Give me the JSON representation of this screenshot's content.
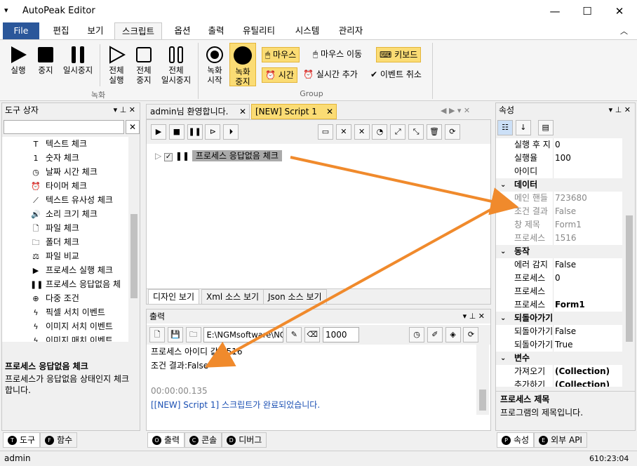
{
  "app": {
    "title": "AutoPeak Editor",
    "menu_glyph": "▾",
    "min": "—",
    "max": "☐",
    "close": "✕",
    "collapse": "︿"
  },
  "menu_tabs": [
    "File",
    "편집",
    "보기",
    "스크립트",
    "옵션",
    "출력",
    "유틸리티",
    "시스템",
    "관리자"
  ],
  "ribbon": {
    "run": "실행",
    "stop": "중지",
    "pause": "일시중지",
    "run_all_1": "전체",
    "run_all_2": "실행",
    "stop_all_1": "전체",
    "stop_all_2": "중지",
    "pause_all_1": "전체",
    "pause_all_2": "일시중지",
    "rec_start_1": "녹화",
    "rec_start_2": "시작",
    "rec_stop_1": "녹화",
    "rec_stop_2": "중지",
    "mouse": "마우스",
    "mouse_move": "마우스 이동",
    "keyboard": "키보드",
    "time": "시간",
    "realtime_add": "실시간 추가",
    "event_cancel": "이벤트 취소",
    "group_record": "녹화",
    "group_group": "Group"
  },
  "toolbox": {
    "title": "도구 상자",
    "search_value": "",
    "items": [
      "텍스트 체크",
      "숫자 체크",
      "날짜 시간 체크",
      "타이머 체크",
      "텍스트 유사성 체크",
      "소리 크기 체크",
      "파일 체크",
      "폴더 체크",
      "파일 비교",
      "프로세스 실행 체크",
      "프로세스 응답없음 체",
      "다중 조건",
      "픽셀 서치 이벤트",
      "이미지 서치 이벤트",
      "이미지 매치 이벤트"
    ],
    "item_icons": [
      "T",
      "1",
      "◷",
      "⏰",
      "⟋",
      "🔊",
      "🗋",
      "🗀",
      "⚖",
      "▶",
      "❚❚",
      "⊕",
      "ϟ",
      "ϟ",
      "ϟ"
    ],
    "desc_title": "프로세스 응답없음 체크",
    "desc_text": "프로세스가 응답없음 상태인지 체크합니다.",
    "tab_tools": "도구",
    "tab_functions": "함수"
  },
  "editor": {
    "tabs": [
      "admin님 환영합니다.",
      "[NEW] Script 1"
    ],
    "node_label": "프로세스 응답없음 체크",
    "view_tabs": [
      "디자인 보기",
      "Xml 소스 보기",
      "Json 소스 보기"
    ]
  },
  "output": {
    "title": "출력",
    "path": "E:\\NGMsoftware\\NG",
    "count": "1000",
    "lines": [
      "프로세스 아이디 값:1516",
      "조건 결과:False"
    ],
    "elapsed": "00:00:00.135",
    "done": "[[NEW] Script 1] 스크립트가 완료되었습니다.",
    "tabs": [
      "출력",
      "콘솔",
      "디버그"
    ]
  },
  "properties": {
    "title": "속성",
    "rows": [
      {
        "k": "실행 후 지",
        "v": "0",
        "type": "row"
      },
      {
        "k": "실행율",
        "v": "100",
        "type": "row"
      },
      {
        "k": "아이디",
        "v": "",
        "type": "row"
      },
      {
        "k": "데이터",
        "type": "cat"
      },
      {
        "k": "메인 핸들",
        "v": "723680",
        "type": "gray"
      },
      {
        "k": "조건 결과",
        "v": "False",
        "type": "gray"
      },
      {
        "k": "창 제목",
        "v": "Form1",
        "type": "gray"
      },
      {
        "k": "프로세스",
        "v": "1516",
        "type": "gray"
      },
      {
        "k": "동작",
        "type": "cat"
      },
      {
        "k": "에러 감지",
        "v": "False",
        "type": "row"
      },
      {
        "k": "프로세스",
        "v": "0",
        "type": "row"
      },
      {
        "k": "프로세스",
        "v": "",
        "type": "row"
      },
      {
        "k": "프로세스",
        "v": "Form1",
        "type": "bold"
      },
      {
        "k": "되돌아가기",
        "type": "cat"
      },
      {
        "k": "되돌아가기",
        "v": "False",
        "type": "row"
      },
      {
        "k": "되돌아가기",
        "v": "True",
        "type": "row"
      },
      {
        "k": "변수",
        "type": "cat"
      },
      {
        "k": "가져오기",
        "v": "(Collection)",
        "type": "bold"
      },
      {
        "k": "추가하기",
        "v": "(Collection)",
        "type": "bold"
      }
    ],
    "desc_title": "프로세스 제목",
    "desc_text": "프로그램의 제목입니다.",
    "tab_props": "속성",
    "tab_api": "외부 API"
  },
  "status": {
    "user": "admin",
    "time": "610:23:04"
  },
  "colors": {
    "accent": "#2b579a",
    "highlight": "#fbdc74",
    "arrow": "#f08a2c"
  }
}
